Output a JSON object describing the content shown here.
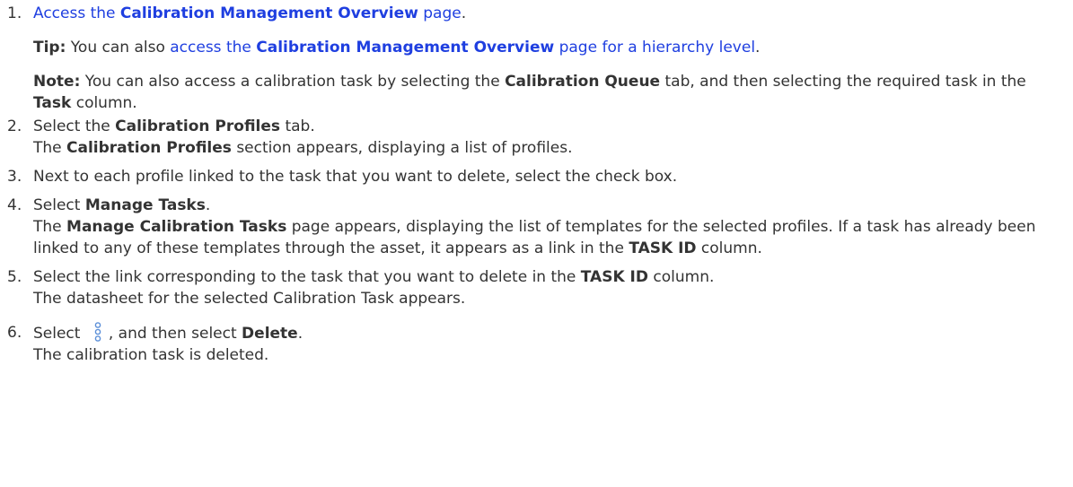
{
  "steps": [
    {
      "number": "1.",
      "link_pre": "Access the ",
      "link_bold": "Calibration Management Overview",
      "link_post": " page",
      "tail": ".",
      "tip": {
        "label": "Tip:",
        "text_pre": " You can also ",
        "link_pre": "access the ",
        "link_bold": "Calibration Management Overview",
        "link_post": " page for a hierarchy level",
        "text_post": "."
      },
      "note": {
        "label": "Note:",
        "t1": " You can also access a calibration task by selecting the ",
        "b1": "Calibration Queue",
        "t2": " tab, and then selecting the required task in the ",
        "b2": "Task",
        "t3": " column."
      }
    },
    {
      "number": "2.",
      "pre": "Select the ",
      "bold": "Calibration Profiles",
      "post": " tab.",
      "result_pre": "The ",
      "result_bold": "Calibration Profiles",
      "result_post": " section appears, displaying a list of profiles."
    },
    {
      "number": "3.",
      "text": "Next to each profile linked to the task that you want to delete, select the check box."
    },
    {
      "number": "4.",
      "pre": "Select ",
      "bold": "Manage Tasks",
      "post": ".",
      "r_t1": "The ",
      "r_b1": "Manage Calibration Tasks",
      "r_t2": " page appears, displaying the list of templates for the selected profiles. If a task has already been linked to any of these templates through the asset, it appears as a link in the ",
      "r_b2": "TASK ID",
      "r_t3": " column."
    },
    {
      "number": "5.",
      "pre": "Select the link corresponding to the task that you want to delete in the ",
      "bold": "TASK ID",
      "post": " column.",
      "result": "The datasheet for the selected Calibration Task appears."
    },
    {
      "number": "6.",
      "pre": "Select ",
      "icon": "vertical-ellipsis-icon",
      "mid": ", and then select ",
      "bold": "Delete",
      "post": ".",
      "result": "The calibration task is deleted."
    }
  ],
  "colors": {
    "text": "#333333",
    "link": "#1f3fe0",
    "icon": "#5b8fd8"
  }
}
